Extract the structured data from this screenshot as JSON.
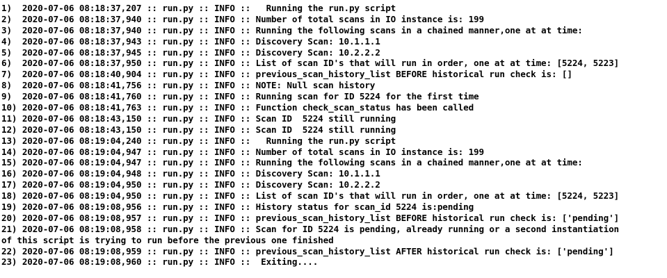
{
  "log_lines": [
    "1)  2020-07-06 08:18:37,207 :: run.py :: INFO ::   Running the run.py script",
    "2)  2020-07-06 08:18:37,940 :: run.py :: INFO :: Number of total scans in IO instance is: 199",
    "3)  2020-07-06 08:18:37,940 :: run.py :: INFO :: Running the following scans in a chained manner,one at at time:",
    "4)  2020-07-06 08:18:37,943 :: run.py :: INFO :: Discovery Scan: 10.1.1.1",
    "5)  2020-07-06 08:18:37,945 :: run.py :: INFO :: Discovery Scan: 10.2.2.2",
    "6)  2020-07-06 08:18:37,950 :: run.py :: INFO :: List of scan ID's that will run in order, one at at time: [5224, 5223]",
    "7)  2020-07-06 08:18:40,904 :: run.py :: INFO :: previous_scan_history_list BEFORE historical run check is: []",
    "8)  2020-07-06 08:18:41,756 :: run.py :: INFO :: NOTE: Null scan history",
    "9)  2020-07-06 08:18:41,760 :: run.py :: INFO :: Running scan for ID 5224 for the first time",
    "10) 2020-07-06 08:18:41,763 :: run.py :: INFO :: Function check_scan_status has been called",
    "11) 2020-07-06 08:18:43,150 :: run.py :: INFO :: Scan ID  5224 still running",
    "12) 2020-07-06 08:18:43,150 :: run.py :: INFO :: Scan ID  5224 still running",
    "13) 2020-07-06 08:19:04,240 :: run.py :: INFO ::   Running the run.py script",
    "14) 2020-07-06 08:19:04,947 :: run.py :: INFO :: Number of total scans in IO instance is: 199",
    "15) 2020-07-06 08:19:04,947 :: run.py :: INFO :: Running the following scans in a chained manner,one at at time:",
    "16) 2020-07-06 08:19:04,948 :: run.py :: INFO :: Discovery Scan: 10.1.1.1",
    "17) 2020-07-06 08:19:04,950 :: run.py :: INFO :: Discovery Scan: 10.2.2.2",
    "18) 2020-07-06 08:19:04,950 :: run.py :: INFO :: List of scan ID's that will run in order, one at at time: [5224, 5223]",
    "19) 2020-07-06 08:19:08,956 :: run.py :: INFO :: History status for scan_id 5224 is:pending",
    "20) 2020-07-06 08:19:08,957 :: run.py :: INFO :: previous_scan_history_list BEFORE historical run check is: ['pending']",
    "21) 2020-07-06 08:19:08,958 :: run.py :: INFO :: Scan for ID 5224 is pending, already running or a second instantiation",
    "of this script is trying to run before the previous one finished",
    "22) 2020-07-06 08:19:08,959 :: run.py :: INFO :: previous_scan_history_list AFTER historical run check is: ['pending']",
    "23) 2020-07-06 08:19:08,960 :: run.py :: INFO ::  Exiting...."
  ]
}
